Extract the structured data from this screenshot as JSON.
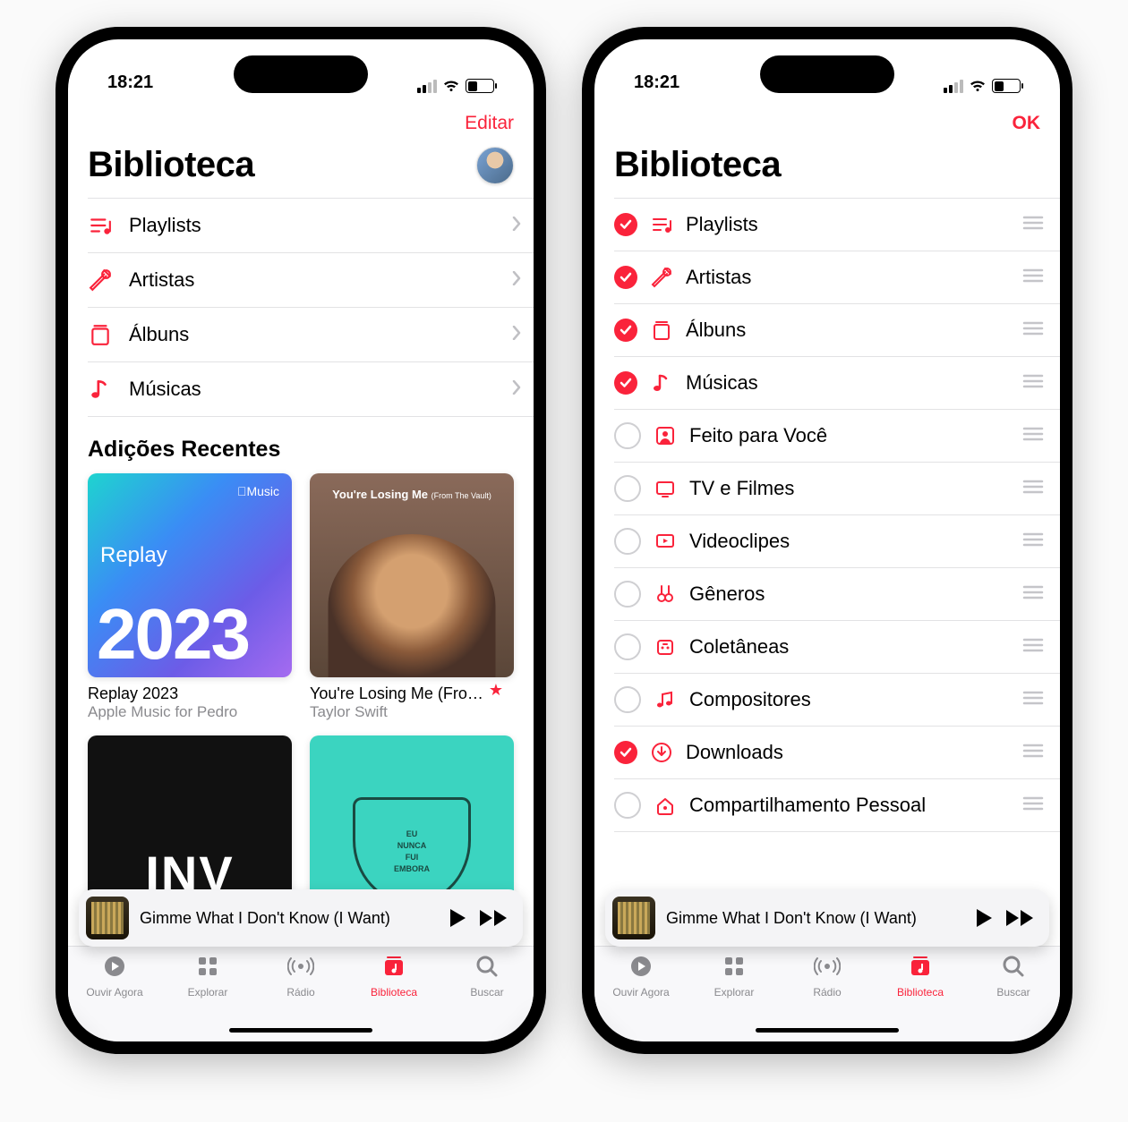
{
  "status": {
    "time": "18:21"
  },
  "left": {
    "nav_button": "Editar",
    "title": "Biblioteca",
    "items": [
      {
        "id": "playlists",
        "label": "Playlists",
        "icon": "playlist"
      },
      {
        "id": "artistas",
        "label": "Artistas",
        "icon": "mic"
      },
      {
        "id": "albuns",
        "label": "Álbuns",
        "icon": "album"
      },
      {
        "id": "musicas",
        "label": "Músicas",
        "icon": "note"
      }
    ],
    "section_title": "Adições Recentes",
    "recents": [
      {
        "title": "Replay 2023",
        "subtitle": "Apple Music for Pedro",
        "art": "replay",
        "tag": "Music",
        "year": "2023",
        "rp": "Replay"
      },
      {
        "title": "You're Losing Me (Fro…",
        "subtitle": "Taylor Swift",
        "art": "losing",
        "starred": true,
        "art_title": "You're Losing Me",
        "art_sub": "(From The Vault)"
      },
      {
        "title": "",
        "subtitle": "",
        "art": "inv",
        "inv_text": "INV"
      },
      {
        "title": "",
        "subtitle": "",
        "art": "teal",
        "teal_l1": "EU",
        "teal_l2": "NUNCA",
        "teal_l3": "FUI",
        "teal_l4": "EMBORA"
      }
    ]
  },
  "right": {
    "nav_button": "OK",
    "title": "Biblioteca",
    "items": [
      {
        "label": "Playlists",
        "icon": "playlist",
        "checked": true
      },
      {
        "label": "Artistas",
        "icon": "mic",
        "checked": true
      },
      {
        "label": "Álbuns",
        "icon": "album",
        "checked": true
      },
      {
        "label": "Músicas",
        "icon": "note",
        "checked": true
      },
      {
        "label": "Feito para Você",
        "icon": "person-sq",
        "checked": false
      },
      {
        "label": "TV e Filmes",
        "icon": "tv",
        "checked": false
      },
      {
        "label": "Videoclipes",
        "icon": "video",
        "checked": false
      },
      {
        "label": "Gêneros",
        "icon": "guitar",
        "checked": false
      },
      {
        "label": "Coletâneas",
        "icon": "box",
        "checked": false
      },
      {
        "label": "Compositores",
        "icon": "two-notes",
        "checked": false
      },
      {
        "label": "Downloads",
        "icon": "download",
        "checked": true
      },
      {
        "label": "Compartilhamento Pessoal",
        "icon": "home",
        "checked": false
      }
    ]
  },
  "now_playing": {
    "title": "Gimme What I Don't Know (I Want)"
  },
  "tabs": [
    {
      "id": "ouvir",
      "label": "Ouvir Agora",
      "icon": "play-circle"
    },
    {
      "id": "explorar",
      "label": "Explorar",
      "icon": "grid"
    },
    {
      "id": "radio",
      "label": "Rádio",
      "icon": "radio"
    },
    {
      "id": "biblioteca",
      "label": "Biblioteca",
      "icon": "library",
      "active": true
    },
    {
      "id": "buscar",
      "label": "Buscar",
      "icon": "search"
    }
  ],
  "colors": {
    "accent": "#fa233b"
  }
}
